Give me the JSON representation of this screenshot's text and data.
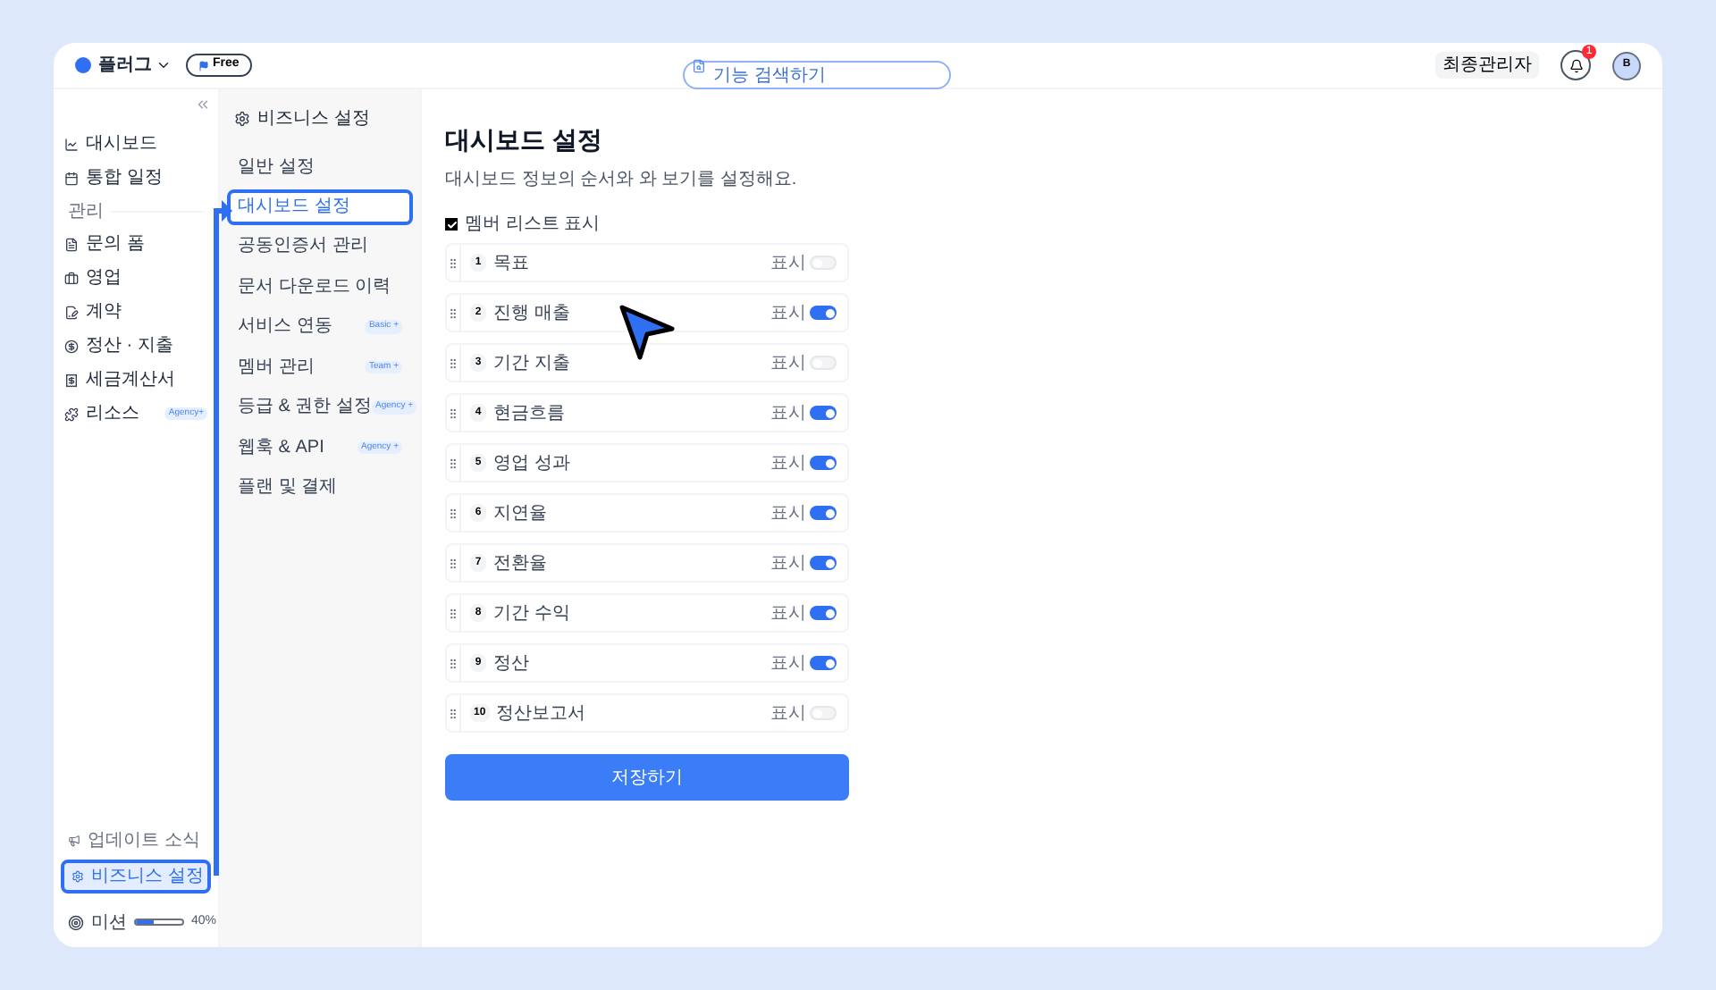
{
  "header": {
    "workspace": "플러그",
    "plan": "Free",
    "search": {
      "placeholder": "기능 검색하기"
    },
    "role": "최종관리자",
    "notifications": "1",
    "avatar": "B"
  },
  "sidebar": {
    "items": [
      {
        "kind": "item",
        "label": "대시보드"
      },
      {
        "kind": "item",
        "label": "통합 일정"
      },
      {
        "kind": "section",
        "label": "관리"
      },
      {
        "kind": "item",
        "label": "문의 폼"
      },
      {
        "kind": "item",
        "label": "영업"
      },
      {
        "kind": "item",
        "label": "계약"
      },
      {
        "kind": "item",
        "label": "정산 · 지출"
      },
      {
        "kind": "item",
        "label": "세금계산서"
      },
      {
        "kind": "item",
        "label": "리소스",
        "badge": "Agency+"
      }
    ],
    "bottom": [
      {
        "label": "업데이트 소식",
        "selected": false
      },
      {
        "label": "비즈니스 설정",
        "selected": true
      }
    ],
    "mission": {
      "label": "미션",
      "level": 0.4,
      "reading": "40%"
    }
  },
  "settings_nav": {
    "title": "비즈니스 설정",
    "items": [
      {
        "label": "일반 설정",
        "selected": false
      },
      {
        "label": "대시보드 설정",
        "selected": true
      },
      {
        "label": "공동인증서 관리",
        "selected": false
      },
      {
        "label": "문서 다운로드 이력",
        "selected": false
      },
      {
        "label": "서비스 연동",
        "selected": false,
        "badge": "Basic +"
      },
      {
        "label": "멤버 관리",
        "selected": false,
        "badge": "Team +"
      },
      {
        "label": "등급 & 권한 설정",
        "selected": false,
        "badge": "Agency +"
      },
      {
        "label": "웹훅 & API",
        "selected": false,
        "badge": "Agency +"
      },
      {
        "label": "플랜 및 결제",
        "selected": false
      }
    ]
  },
  "main": {
    "title": "대시보드 설정",
    "description": "대시보드 정보의 순서와 와 보기를 설정해요.",
    "member_list": {
      "label": "멤버 리스트 표시",
      "checked": true
    },
    "widgets": [
      {
        "number": "1",
        "label": "목표",
        "toggle_label": "표시",
        "on": false
      },
      {
        "number": "2",
        "label": "진행 매출",
        "toggle_label": "표시",
        "on": true
      },
      {
        "number": "3",
        "label": "기간 지출",
        "toggle_label": "표시",
        "on": false
      },
      {
        "number": "4",
        "label": "현금흐름",
        "toggle_label": "표시",
        "on": true
      },
      {
        "number": "5",
        "label": "영업 성과",
        "toggle_label": "표시",
        "on": true
      },
      {
        "number": "6",
        "label": "지연율",
        "toggle_label": "표시",
        "on": true
      },
      {
        "number": "7",
        "label": "전환율",
        "toggle_label": "표시",
        "on": true
      },
      {
        "number": "8",
        "label": "기간 수익",
        "toggle_label": "표시",
        "on": true
      },
      {
        "number": "9",
        "label": "정산",
        "toggle_label": "표시",
        "on": true
      },
      {
        "number": "10",
        "label": "정산보고서",
        "toggle_label": "표시",
        "on": false
      }
    ],
    "save_button": "저장하기"
  }
}
